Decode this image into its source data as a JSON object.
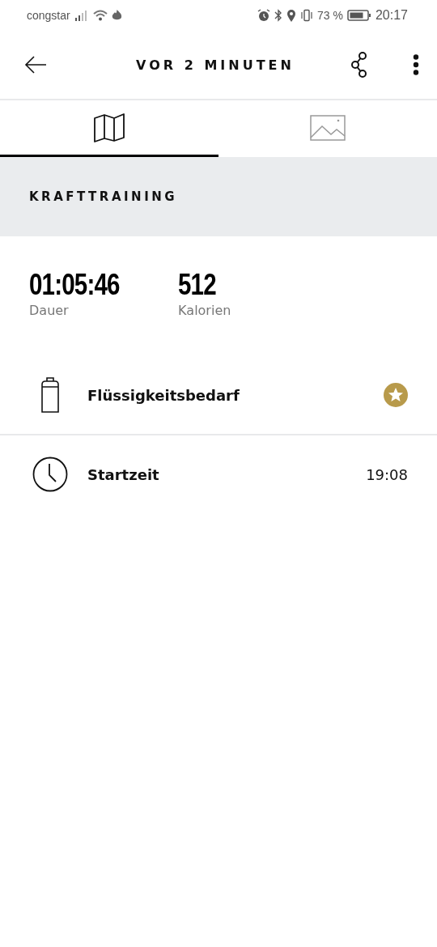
{
  "status_bar": {
    "carrier": "congstar",
    "battery": "73 %",
    "time": "20:17"
  },
  "app_bar": {
    "title": "VOR 2 MINUTEN"
  },
  "tabs": [
    {
      "kind": "map",
      "selected": true
    },
    {
      "kind": "photo",
      "selected": false
    }
  ],
  "section": {
    "title": "KRAFTTRAINING"
  },
  "stats": [
    {
      "value": "01:05:46",
      "label": "Dauer"
    },
    {
      "value": "512",
      "label": "Kalorien"
    }
  ],
  "rows": [
    {
      "kind": "badge",
      "label": "Flüssigkeitsbedarf"
    },
    {
      "kind": "value",
      "label": "Startzeit",
      "value": "19:08"
    }
  ]
}
